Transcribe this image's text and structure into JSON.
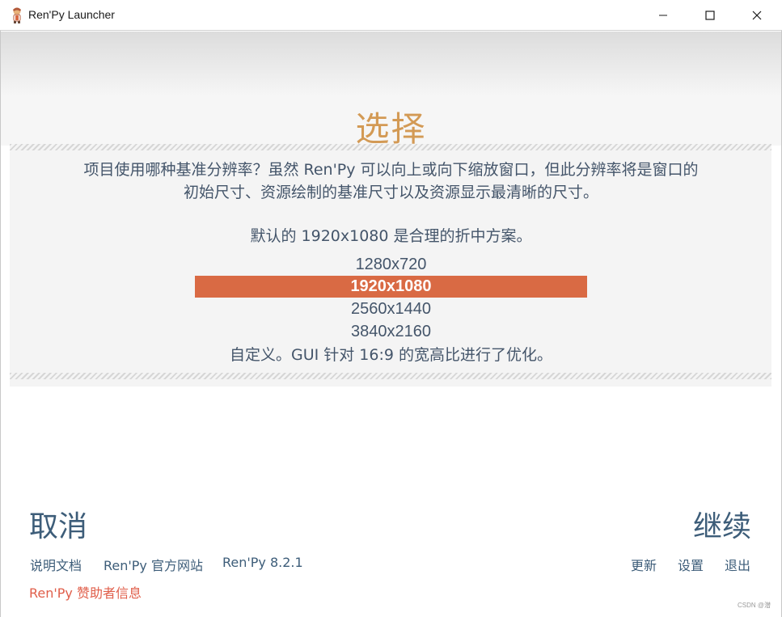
{
  "window": {
    "title": "Ren'Py Launcher"
  },
  "page": {
    "title": "选择",
    "description": "项目使用哪种基准分辨率？虽然 Ren'Py 可以向上或向下缩放窗口，但此分辨率将是窗口的初始尺寸、资源绘制的基准尺寸以及资源显示最清晰的尺寸。",
    "default_note": "默认的 1920x1080 是合理的折中方案。",
    "resolutions": [
      "1280x720",
      "1920x1080",
      "2560x1440",
      "3840x2160"
    ],
    "selected_resolution": "1920x1080",
    "custom_option": "自定义。GUI 针对 16:9 的宽高比进行了优化。"
  },
  "actions": {
    "cancel": "取消",
    "continue": "继续"
  },
  "footer": {
    "left_links": [
      "说明文档",
      "Ren'Py 官方网站",
      "Ren'Py 8.2.1"
    ],
    "right_links": [
      "更新",
      "设置",
      "退出"
    ],
    "sponsor": "Ren'Py 赞助者信息"
  },
  "watermark": "CSDN @潜",
  "colors": {
    "title": "#d39a55",
    "selected_bg": "#d96a44",
    "text": "#44556a",
    "link": "#3d5d79",
    "sponsor": "#e05e4a"
  }
}
